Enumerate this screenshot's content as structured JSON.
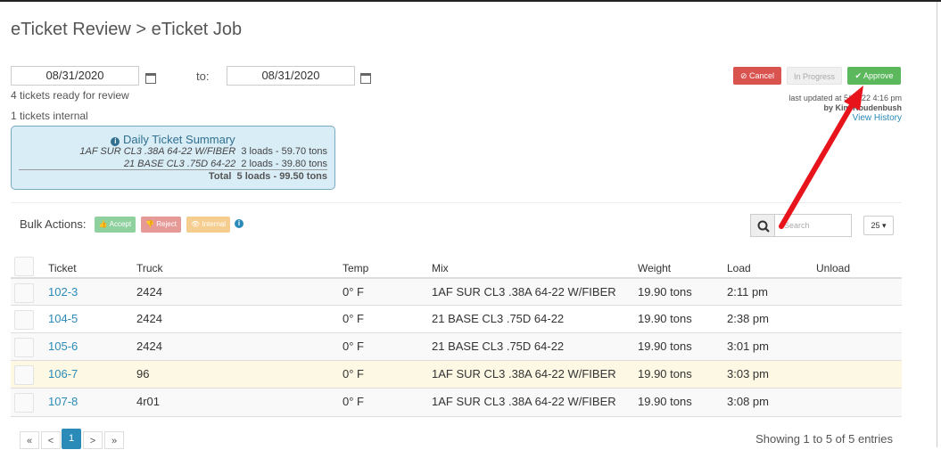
{
  "header": {
    "title": "eTicket Review > eTicket Job"
  },
  "dates": {
    "from": "08/31/2020",
    "to_label": "to:",
    "to": "08/31/2020"
  },
  "status": {
    "ready": "4 tickets ready for review",
    "internal": "1 tickets internal"
  },
  "buttons": {
    "cancel": "⊘ Cancel",
    "in_progress": "In Progress",
    "approve": "✔ Approve"
  },
  "update": {
    "line1": "last updated at 5/18/22 4:16 pm",
    "line2": "by Kim Roudenbush",
    "history": "View History"
  },
  "summary": {
    "title": "Daily Ticket Summary",
    "lines": [
      {
        "mix": "1AF SUR CL3 .38A 64-22 W/FIBER",
        "value": "3 loads - 59.70 tons"
      },
      {
        "mix": "21 BASE CL3 .75D 64-22",
        "value": "2 loads - 39.80 tons"
      }
    ],
    "total_label": "Total",
    "total_value": "5 loads - 99.50 tons"
  },
  "bulk": {
    "label": "Bulk Actions:",
    "accept": "👍 Accept",
    "reject": "👎 Reject",
    "internal": "👁 Internal"
  },
  "search": {
    "placeholder": "Search",
    "page_size": "25 ▾"
  },
  "table": {
    "headers": [
      "Ticket",
      "Truck",
      "Temp",
      "Mix",
      "Weight",
      "Load",
      "Unload"
    ],
    "rows": [
      {
        "ticket": "102-3",
        "truck": "2424",
        "temp": "0° F",
        "mix": "1AF SUR CL3 .38A 64-22 W/FIBER",
        "weight": "19.90 tons",
        "load": "2:11 pm",
        "unload": ""
      },
      {
        "ticket": "104-5",
        "truck": "2424",
        "temp": "0° F",
        "mix": "21 BASE CL3 .75D 64-22",
        "weight": "19.90 tons",
        "load": "2:38 pm",
        "unload": ""
      },
      {
        "ticket": "105-6",
        "truck": "2424",
        "temp": "0° F",
        "mix": "21 BASE CL3 .75D 64-22",
        "weight": "19.90 tons",
        "load": "3:01 pm",
        "unload": ""
      },
      {
        "ticket": "106-7",
        "truck": "96",
        "temp": "0° F",
        "mix": "1AF SUR CL3 .38A 64-22 W/FIBER",
        "weight": "19.90 tons",
        "load": "3:03 pm",
        "unload": ""
      },
      {
        "ticket": "107-8",
        "truck": "4r01",
        "temp": "0° F",
        "mix": "1AF SUR CL3 .38A 64-22 W/FIBER",
        "weight": "19.90 tons",
        "load": "3:08 pm",
        "unload": ""
      }
    ]
  },
  "pagination": {
    "first": "«",
    "prev": "<",
    "current": "1",
    "next": ">",
    "last": "»",
    "info": "Showing 1 to 5 of 5 entries"
  },
  "colors": {
    "cancel": "#d9534f",
    "approve": "#5cb85c",
    "link": "#2a8ab8",
    "highlight_row": "#fcf8e3",
    "summary_bg": "#d9edf7"
  }
}
